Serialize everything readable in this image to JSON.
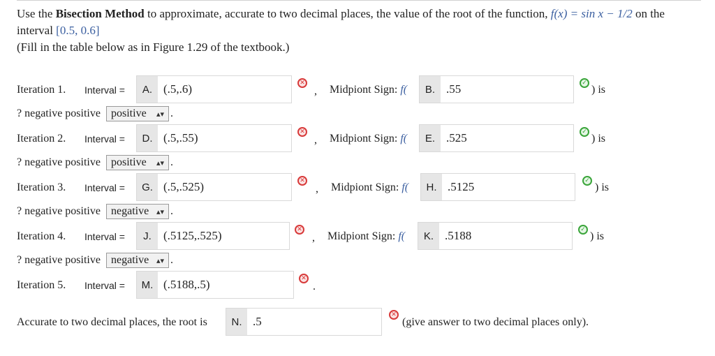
{
  "intro": {
    "line1_a": "Use the ",
    "line1_bold": "Bisection Method",
    "line1_b": " to approximate, accurate to two decimal places, the value of the root of the function, ",
    "func": "f(x) = sin x − 1/2",
    "line1_c": " on the",
    "line2_a": "interval ",
    "interval": "[0.5, 0.6]",
    "line3": "(Fill in the table below as in Figure 1.29 of the textbook.)"
  },
  "labels": {
    "interval": "Interval =",
    "midpoint": "Midpiont Sign:",
    "fparen": "f(",
    "is": ") is",
    "prompt": "? negative positive",
    "comma": ",",
    "period": "."
  },
  "iterations": [
    {
      "label": "Iteration 1.",
      "interval_letter": "A.",
      "interval_value": "(.5,.6)",
      "mid_letter": "B.",
      "mid_value": ".55",
      "sign": "positive"
    },
    {
      "label": "Iteration 2.",
      "interval_letter": "D.",
      "interval_value": "(.5,.55)",
      "mid_letter": "E.",
      "mid_value": ".525",
      "sign": "positive"
    },
    {
      "label": "Iteration 3.",
      "interval_letter": "G.",
      "interval_value": "(.5,.525)",
      "mid_letter": "H.",
      "mid_value": ".5125",
      "sign": "negative"
    },
    {
      "label": "Iteration 4.",
      "interval_letter": "J.",
      "interval_value": "(.5125,.525)",
      "mid_letter": "K.",
      "mid_value": ".5188",
      "sign": "negative"
    },
    {
      "label": "Iteration 5.",
      "interval_letter": "M.",
      "interval_value": "(.5188,.5)"
    }
  ],
  "final": {
    "label": "Accurate to two decimal places, the root is",
    "letter": "N.",
    "value": ".5",
    "hint": "(give answer to two decimal places only)."
  },
  "icons": {
    "incorrect": "x-circle-icon",
    "correct": "check-circle-icon"
  },
  "colors": {
    "incorrect": "#d83a3a",
    "correct": "#3aa53a",
    "link": "#3b5fa0"
  }
}
